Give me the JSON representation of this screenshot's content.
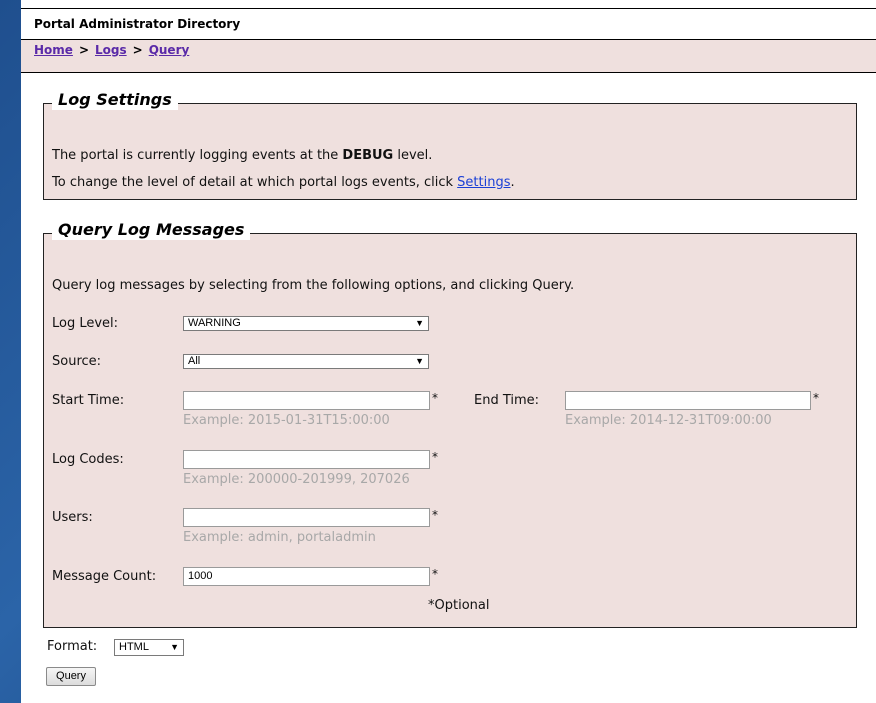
{
  "header": {
    "title": "Portal Administrator Directory"
  },
  "breadcrumb": {
    "home": "Home",
    "logs": "Logs",
    "query": "Query",
    "separator": ">"
  },
  "log_settings": {
    "legend": "Log Settings",
    "line1_prefix": "The portal is currently logging events at the ",
    "line1_level": "DEBUG",
    "line1_suffix": " level.",
    "line2_prefix": "To change the level of detail at which portal logs events, click ",
    "line2_link": "Settings",
    "line2_suffix": "."
  },
  "query": {
    "legend": "Query Log Messages",
    "intro": "Query log messages by selecting from the following options, and clicking Query.",
    "log_level": {
      "label": "Log Level:",
      "value": "WARNING"
    },
    "source": {
      "label": "Source:",
      "value": "All"
    },
    "start_time": {
      "label": "Start Time:",
      "value": "",
      "example": "Example: 2015-01-31T15:00:00"
    },
    "end_time": {
      "label": "End Time:",
      "value": "",
      "example": "Example: 2014-12-31T09:00:00"
    },
    "log_codes": {
      "label": "Log Codes:",
      "value": "",
      "example": "Example: 200000-201999, 207026"
    },
    "users": {
      "label": "Users:",
      "value": "",
      "example": "Example: admin, portaladmin"
    },
    "message_count": {
      "label": "Message Count:",
      "value": "1000"
    },
    "required_mark": "*",
    "optional_note": "*Optional"
  },
  "footer": {
    "format_label": "Format:",
    "format_value": "HTML",
    "query_button": "Query"
  },
  "icons": {
    "dropdown_arrow": "▼"
  }
}
